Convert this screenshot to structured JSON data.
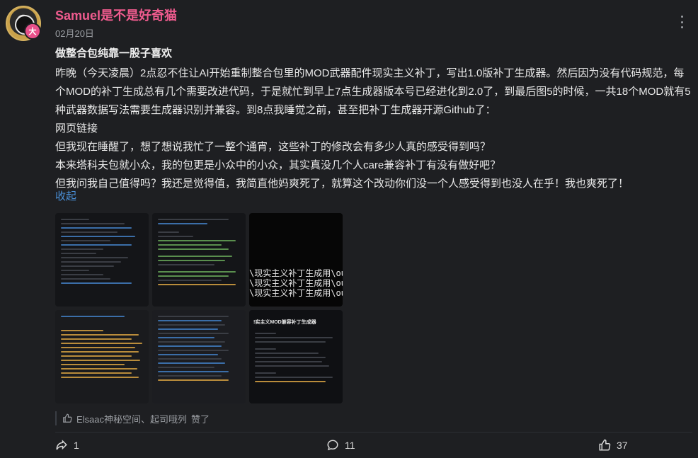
{
  "author": {
    "name": "Samuel是不是好奇猫",
    "date": "02月20日",
    "badge": "大"
  },
  "post": {
    "title": "做整合包纯靠一股子喜欢",
    "paragraphs": [
      "昨晚（今天凌晨）2点忍不住让AI开始重制整合包里的MOD武器配件现实主义补丁，写出1.0版补丁生成器。然后因为没有代码规范，每个MOD的补丁生成总有几个需要改进代码，于是就忙到早上7点生成器版本号已经进化到2.0了，到最后图5的时候，一共18个MOD就有5种武器数据写法需要生成器识别并兼容。到8点我睡觉之前，甚至把补丁生成器开源Github了：",
      "网页链接",
      "但我现在睡醒了，想了想说我忙了一整个通宵，这些补丁的修改会有多少人真的感受得到吗？",
      "本来塔科夫包就小众，我的包更是小众中的小众，其实真没几个人care兼容补丁有没有做好吧？",
      "但我问我自己值得吗？我还是觉得值，我简直他妈爽死了，就算这个改动你们没一个人感受得到也没人在乎！我也爽死了！"
    ],
    "collapse_label": "收起"
  },
  "thumbnails": {
    "t3_lines": [
      "\\现实主义补丁生成用\\outpu",
      "\\现实主义补丁生成用\\outpu",
      "\\现实主义补丁生成用\\outpu"
    ],
    "t6_title": "!实主义MOD兼容补丁生成器"
  },
  "likes": {
    "names": "Elsaac神秘空间、起司哦列",
    "suffix": "赞了"
  },
  "actions": {
    "share_count": "1",
    "comment_count": "11",
    "like_count": "37"
  },
  "colors": {
    "username": "#ef5b8e",
    "link": "#4a90d9",
    "background": "#1e1f22"
  }
}
